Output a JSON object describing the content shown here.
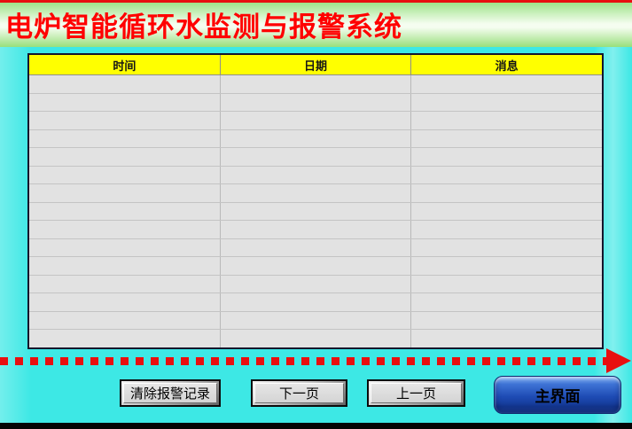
{
  "window": {
    "title": "电炉智能循环水监测与报警系统"
  },
  "colors": {
    "background": "#3DE8E5",
    "top_border": "#E81010",
    "header_gradient_top": "#9FE389",
    "header_gradient_mid": "#F5FDF0",
    "header_gradient_bottom": "#98DF7C",
    "title_text": "#FF0000",
    "table_header_bg": "#FFFF00",
    "table_cell_bg": "#E2E2E2",
    "dashed_arrow": "#E80F0F",
    "main_button_blue": "#1E4BB4",
    "bottom_bar": "#050505"
  },
  "table": {
    "headers": [
      "时间",
      "日期",
      "消息"
    ],
    "rows": [
      [
        "",
        "",
        ""
      ],
      [
        "",
        "",
        ""
      ],
      [
        "",
        "",
        ""
      ],
      [
        "",
        "",
        ""
      ],
      [
        "",
        "",
        ""
      ],
      [
        "",
        "",
        ""
      ],
      [
        "",
        "",
        ""
      ],
      [
        "",
        "",
        ""
      ],
      [
        "",
        "",
        ""
      ],
      [
        "",
        "",
        ""
      ],
      [
        "",
        "",
        ""
      ],
      [
        "",
        "",
        ""
      ],
      [
        "",
        "",
        ""
      ],
      [
        "",
        "",
        ""
      ],
      [
        "",
        "",
        ""
      ]
    ]
  },
  "buttons": {
    "clear": "清除报警记录",
    "next": "下一页",
    "prev": "上一页",
    "main": "主界面"
  },
  "icons": {
    "arrow_right": "red-dashed-right-arrow"
  }
}
